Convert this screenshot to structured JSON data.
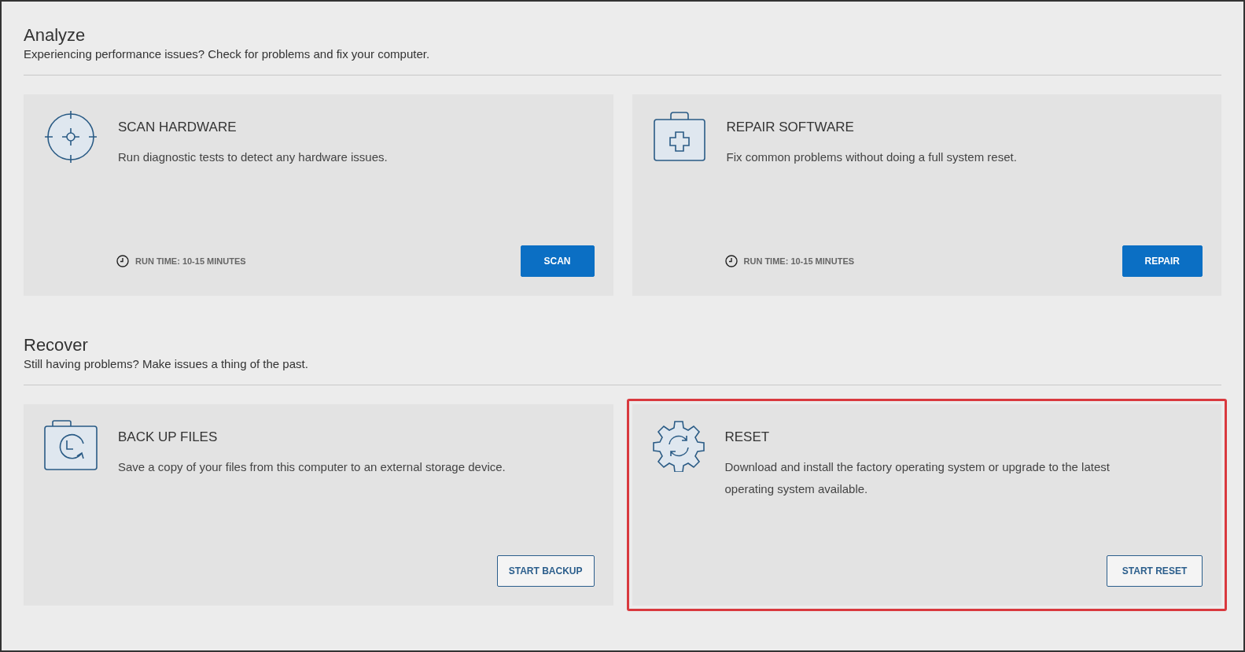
{
  "sections": [
    {
      "title": "Analyze",
      "subtitle": "Experiencing performance issues? Check for problems and fix your computer.",
      "cards": [
        {
          "title": "SCAN HARDWARE",
          "description": "Run diagnostic tests to detect any hardware issues.",
          "run_time": "RUN TIME: 10-15 MINUTES",
          "button": {
            "label": "SCAN",
            "kind": "primary"
          },
          "highlighted": false
        },
        {
          "title": "REPAIR SOFTWARE",
          "description": "Fix common problems without doing a full system reset.",
          "run_time": "RUN TIME: 10-15 MINUTES",
          "button": {
            "label": "REPAIR",
            "kind": "primary"
          },
          "highlighted": false
        }
      ]
    },
    {
      "title": "Recover",
      "subtitle": "Still having problems? Make issues a thing of the past.",
      "cards": [
        {
          "title": "BACK UP FILES",
          "description": "Save a copy of your files from this computer to an external storage device.",
          "button": {
            "label": "START BACKUP",
            "kind": "outline"
          },
          "highlighted": false
        },
        {
          "title": "RESET",
          "description": "Download and install the factory operating system or upgrade to the latest operating system available.",
          "button": {
            "label": "START RESET",
            "kind": "outline"
          },
          "highlighted": true
        }
      ]
    }
  ]
}
